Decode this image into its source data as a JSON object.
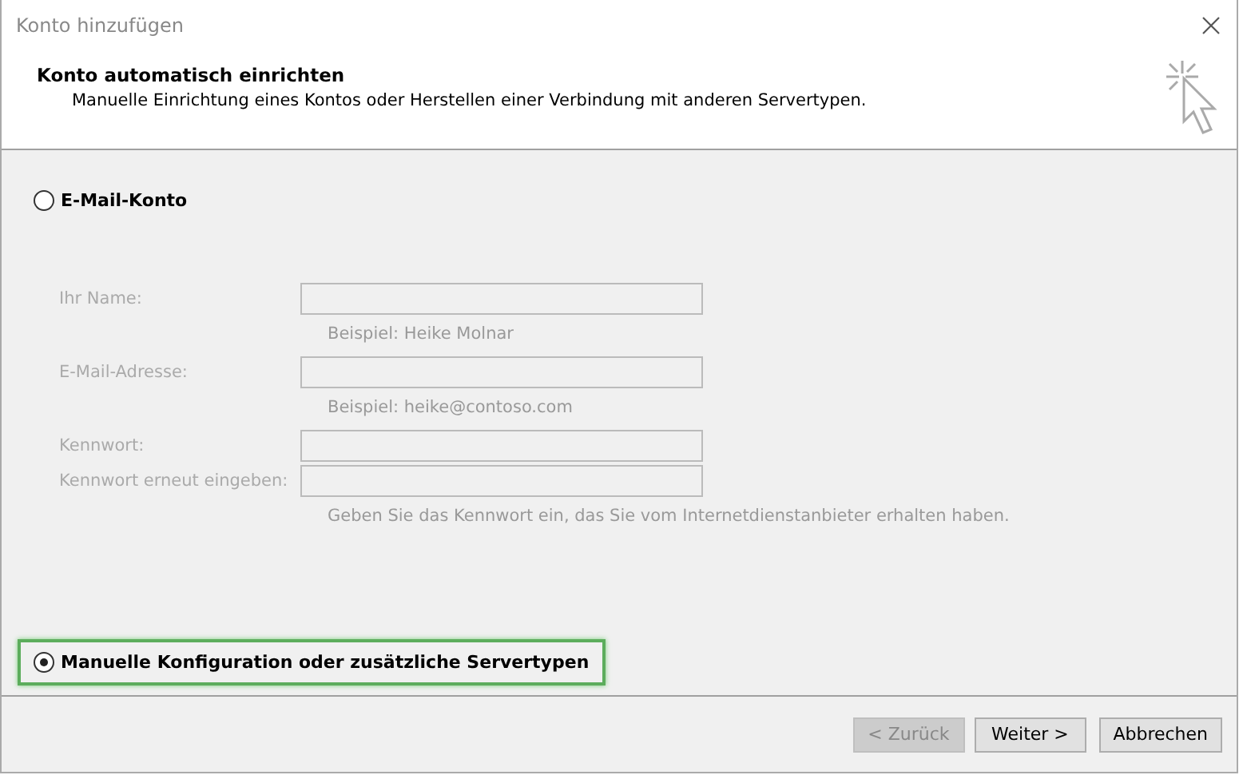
{
  "window": {
    "title": "Konto hinzufügen"
  },
  "header": {
    "title": "Konto automatisch einrichten",
    "subtitle": "Manuelle Einrichtung eines Kontos oder Herstellen einer Verbindung mit anderen Servertypen."
  },
  "options": [
    {
      "label": "E-Mail-Konto",
      "selected": false,
      "highlighted": false
    },
    {
      "label": "Manuelle Konfiguration oder zusätzliche Servertypen",
      "selected": true,
      "highlighted": true
    }
  ],
  "fields": [
    {
      "label": "Ihr Name:",
      "disabled": true,
      "hint": "Beispiel: Heike Molnar"
    },
    {
      "label": "E-Mail-Adresse:",
      "disabled": true,
      "hint": "Beispiel: heike@contoso.com"
    },
    {
      "label": "Kennwort:",
      "disabled": true
    },
    {
      "label": "Kennwort erneut eingeben:",
      "disabled": true,
      "hint": "Geben Sie das Kennwort ein, das Sie vom Internetdienstanbieter erhalten haben."
    }
  ],
  "buttons": [
    {
      "label": "< Zurück",
      "disabled": true
    },
    {
      "label": "Weiter >",
      "disabled": false
    },
    {
      "label": "Abbrechen",
      "disabled": false
    }
  ]
}
